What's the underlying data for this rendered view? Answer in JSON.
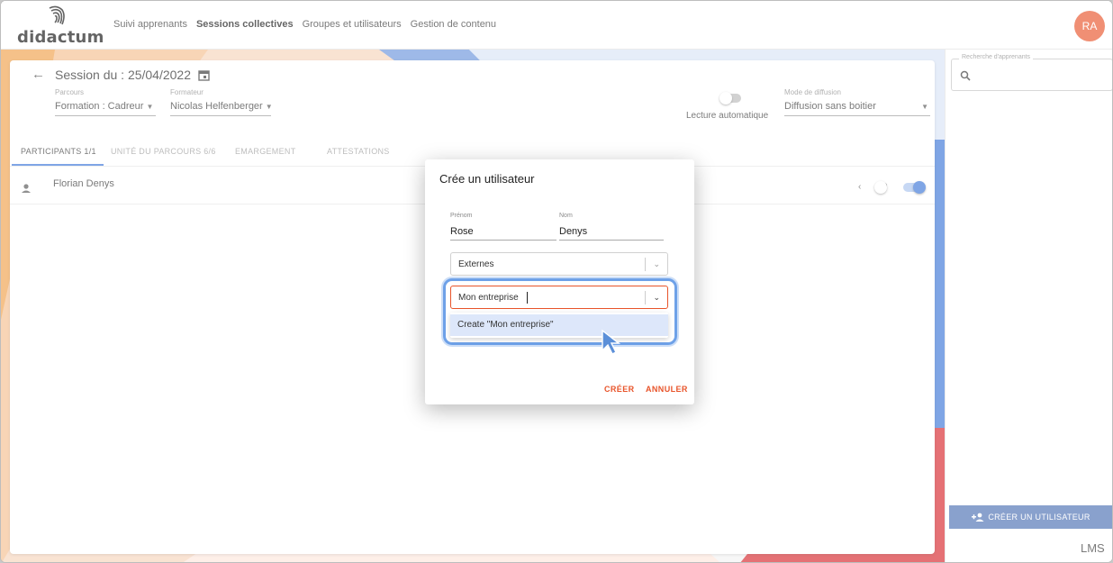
{
  "header": {
    "logo_text": "didactum",
    "nav": [
      "Suivi apprenants",
      "Sessions collectives",
      "Groupes et utilisateurs",
      "Gestion de contenu"
    ],
    "avatar_initials": "RA"
  },
  "session": {
    "title": "Session du : 25/04/2022",
    "parcours_label": "Parcours",
    "parcours_value": "Formation : Cadreur",
    "formateur_label": "Formateur",
    "formateur_value": "Nicolas Helfenberger",
    "autoplay_label": "Lecture automatique",
    "diffusion_label": "Mode de diffusion",
    "diffusion_value": "Diffusion sans boitier"
  },
  "tabs": [
    "PARTICIPANTS 1/1",
    "UNITÉ DU PARCOURS 6/6",
    "EMARGEMENT",
    "ATTESTATIONS"
  ],
  "participants": [
    {
      "name": "Florian Denys"
    }
  ],
  "sidebar": {
    "search_label": "Recherche d'apprenants",
    "create_user_button": "CRÉER UN UTILISATEUR",
    "brand": "LMS"
  },
  "dialog": {
    "title": "Crée un utilisateur",
    "firstname_label": "Prénom",
    "firstname_value": "Rose",
    "lastname_label": "Nom",
    "lastname_value": "Denys",
    "group_value": "Externes",
    "company_value": "Mon entreprise",
    "create_option": "Create \"Mon entreprise\"",
    "create_button": "CRÉER",
    "cancel_button": "ANNULER"
  },
  "colors": {
    "accent": "#e8542a",
    "primary_blue": "#3b76d8",
    "highlight": "#6ea1e8",
    "button_blue": "#4a6fb3"
  }
}
